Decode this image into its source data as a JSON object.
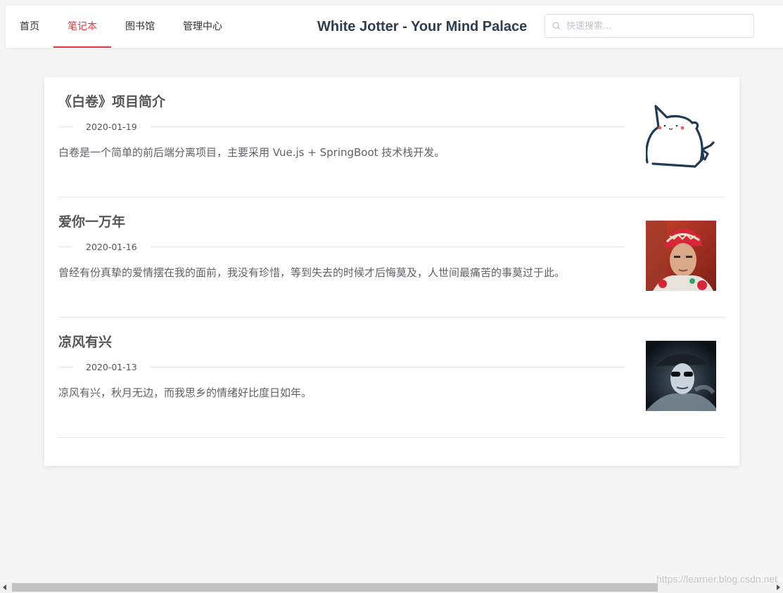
{
  "nav": {
    "items": [
      {
        "label": "首页",
        "active": false
      },
      {
        "label": "笔记本",
        "active": true
      },
      {
        "label": "图书馆",
        "active": false
      },
      {
        "label": "管理中心",
        "active": false
      }
    ]
  },
  "header": {
    "title": "White Jotter - Your Mind Palace"
  },
  "search": {
    "placeholder": "快速搜索...",
    "value": "",
    "icon": "search-icon"
  },
  "articles": [
    {
      "title": "《白卷》项目简介",
      "date": "2020-01-19",
      "summary": "白卷是一个简单的前后端分离项目，主要采用 Vue.js + SpringBoot 技术栈开发。",
      "thumbnail": "cartoon-cat"
    },
    {
      "title": "爱你一万年",
      "date": "2020-01-16",
      "summary": "曾经有份真挚的爱情摆在我的面前，我没有珍惜，等到失去的时候才后悔莫及，人世间最痛苦的事莫过于此。",
      "thumbnail": "portrait-red-costume"
    },
    {
      "title": "凉风有兴",
      "date": "2020-01-13",
      "summary": "凉风有兴，秋月无边，而我思乡的情绪好比度日如年。",
      "thumbnail": "portrait-dark-sunglasses"
    }
  ],
  "watermark": "https://learner.blog.csdn.net",
  "colors": {
    "accent": "#e4393c",
    "title": "#2c3e50",
    "background": "#f5f5f5"
  }
}
